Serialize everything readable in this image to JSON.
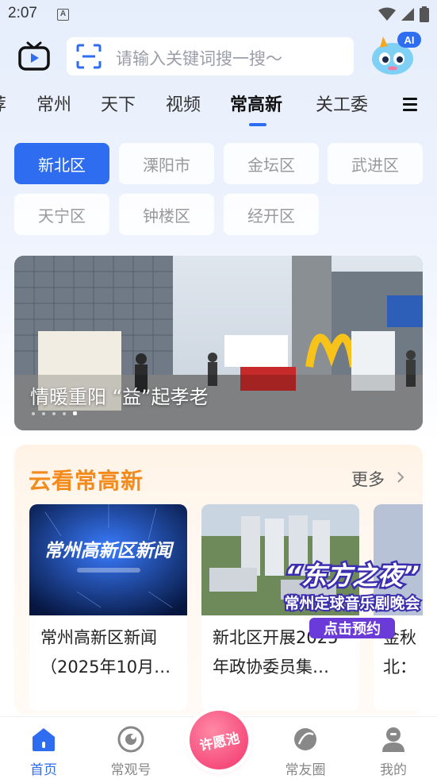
{
  "status_bar": {
    "time": "2:07",
    "notification_letter": "A"
  },
  "search": {
    "placeholder": "请输入关键词搜一搜～",
    "ai_badge": "AI"
  },
  "tabs": [
    {
      "label": "荐",
      "active": false
    },
    {
      "label": "常州",
      "active": false
    },
    {
      "label": "天下",
      "active": false
    },
    {
      "label": "视频",
      "active": false
    },
    {
      "label": "常高新",
      "active": true
    },
    {
      "label": "关工委",
      "active": false
    }
  ],
  "districts": [
    {
      "label": "新北区",
      "active": true
    },
    {
      "label": "溧阳市",
      "active": false
    },
    {
      "label": "金坛区",
      "active": false
    },
    {
      "label": "武进区",
      "active": false
    },
    {
      "label": "天宁区",
      "active": false
    },
    {
      "label": "钟楼区",
      "active": false
    },
    {
      "label": "经开区",
      "active": false
    }
  ],
  "banner": {
    "title": "情暖重阳 “益”起孝老",
    "slide_count": 5,
    "active_slide": 5
  },
  "section": {
    "title": "云看常高新",
    "more_label": "更多",
    "cards": [
      {
        "title_line1": "常州高新区新闻",
        "title_line2": "（2025年10月…",
        "thumb_text": "常州高新区新闻"
      },
      {
        "title_line1": "新北区开展2025",
        "title_line2": "年政协委员集…"
      },
      {
        "title_line1": "金秋",
        "title_line2": "北："
      }
    ]
  },
  "promo": {
    "line1": "“东方之夜”",
    "line2": "常州定球音乐剧晚会",
    "button": "点击预约"
  },
  "bottom_nav": [
    {
      "label": "首页",
      "icon": "home-icon",
      "active": true
    },
    {
      "label": "常观号",
      "icon": "observe-icon",
      "active": false
    },
    {
      "label": "许愿池",
      "icon": "wish-pool-icon",
      "active": false
    },
    {
      "label": "常友圈",
      "icon": "circle-icon",
      "active": false
    },
    {
      "label": "我的",
      "icon": "profile-icon",
      "active": false
    }
  ],
  "colors": {
    "accent": "#2f6df0",
    "section_title": "#f28a1c",
    "wish": "#f2336a"
  }
}
